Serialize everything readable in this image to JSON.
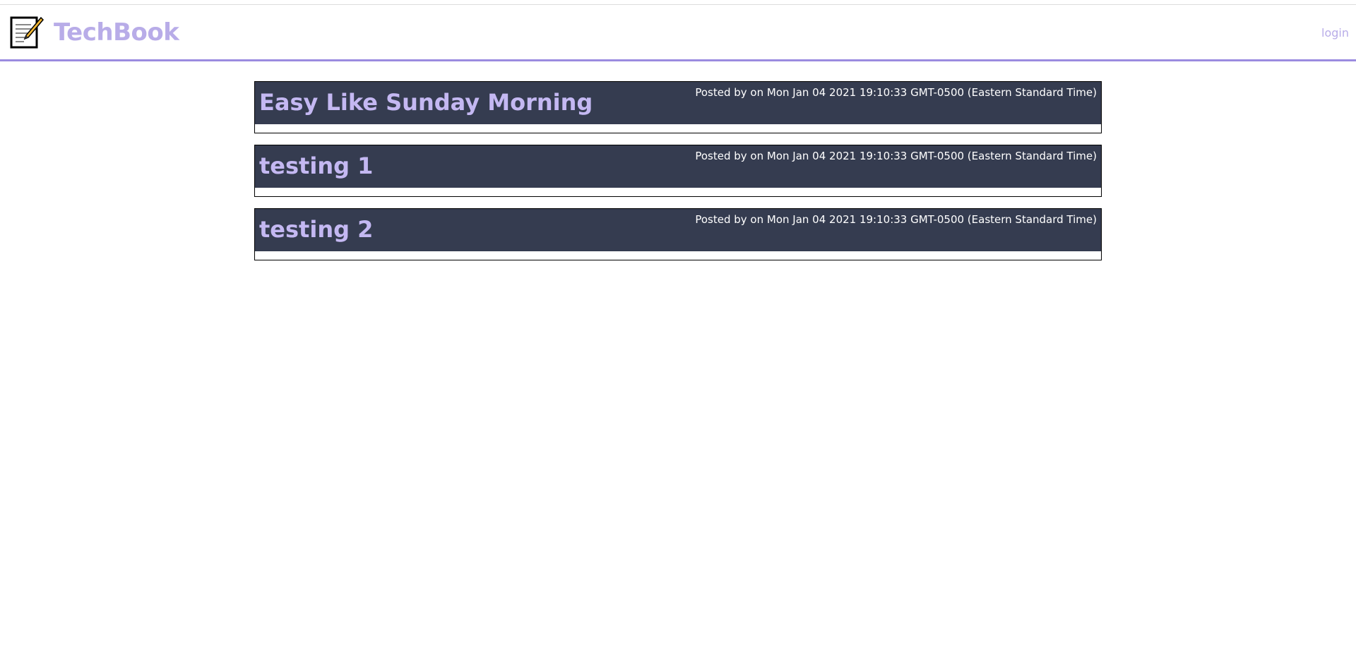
{
  "header": {
    "brand": "TechBook",
    "logo_icon": "notepad-pencil-icon",
    "login_label": "login"
  },
  "posts": [
    {
      "title": "Easy Like Sunday Morning",
      "meta": "Posted by on Mon Jan 04 2021 19:10:33 GMT-0500 (Eastern Standard Time)"
    },
    {
      "title": "testing 1",
      "meta": "Posted by on Mon Jan 04 2021 19:10:33 GMT-0500 (Eastern Standard Time)"
    },
    {
      "title": "testing 2",
      "meta": "Posted by on Mon Jan 04 2021 19:10:33 GMT-0500 (Eastern Standard Time)"
    }
  ],
  "colors": {
    "accent": "#9b8be0",
    "brand": "#b8ace8",
    "post_header_bg": "#353c50",
    "post_title": "#c4b8f2"
  }
}
